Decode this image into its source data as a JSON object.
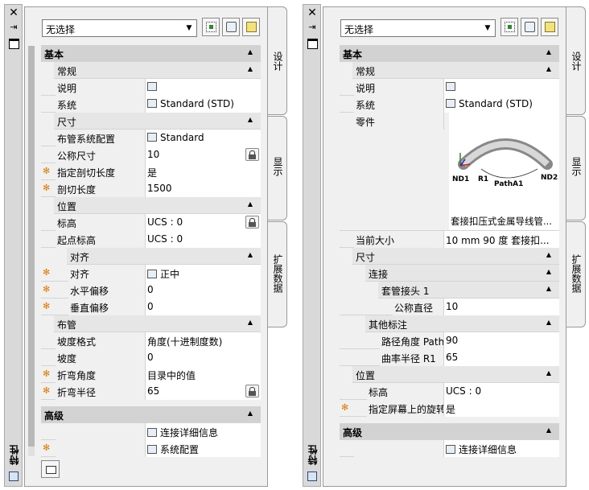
{
  "palette1": {
    "title": "特性",
    "selector": "无选择",
    "tabs": [
      "设计",
      "显示",
      "扩展数据"
    ],
    "rows": [
      {
        "kind": "cat",
        "level": 0,
        "label": "基本",
        "caret": "▲"
      },
      {
        "kind": "cat",
        "level": 1,
        "label": "常规",
        "caret": "▲"
      },
      {
        "kind": "prop",
        "level": 1,
        "label": "说明",
        "value": "",
        "icon": "table-icon"
      },
      {
        "kind": "prop",
        "level": 1,
        "label": "系统",
        "value": "Standard (STD)",
        "icon": "system-icon"
      },
      {
        "kind": "cat",
        "level": 1,
        "label": "尺寸",
        "caret": "▲"
      },
      {
        "kind": "prop",
        "level": 1,
        "label": "布管系统配置",
        "value": "Standard",
        "icon": "pipe-config-icon"
      },
      {
        "kind": "prop",
        "level": 1,
        "label": "公称尺寸",
        "value": "10",
        "lock": true
      },
      {
        "kind": "prop",
        "level": 1,
        "label": "指定剖切长度",
        "value": "是",
        "star": true
      },
      {
        "kind": "prop",
        "level": 1,
        "label": "剖切长度",
        "value": "1500",
        "star": true
      },
      {
        "kind": "cat",
        "level": 1,
        "label": "位置",
        "caret": "▲"
      },
      {
        "kind": "prop",
        "level": 1,
        "label": "标高",
        "value": "UCS : 0",
        "lock": true
      },
      {
        "kind": "prop",
        "level": 1,
        "label": "起点标高",
        "value": "UCS : 0"
      },
      {
        "kind": "cat",
        "level": 2,
        "label": "对齐",
        "caret": "▲"
      },
      {
        "kind": "prop",
        "level": 2,
        "label": "对齐",
        "value": "正中",
        "icon": "align-icon",
        "star": true
      },
      {
        "kind": "prop",
        "level": 2,
        "label": "水平偏移",
        "value": "0",
        "star": true
      },
      {
        "kind": "prop",
        "level": 2,
        "label": "垂直偏移",
        "value": "0",
        "star": true
      },
      {
        "kind": "cat",
        "level": 1,
        "label": "布管",
        "caret": "▲"
      },
      {
        "kind": "prop",
        "level": 1,
        "label": "坡度格式",
        "value": "角度(十进制度数)"
      },
      {
        "kind": "prop",
        "level": 1,
        "label": "坡度",
        "value": "0"
      },
      {
        "kind": "prop",
        "level": 1,
        "label": "折弯角度",
        "value": "目录中的值",
        "star": true
      },
      {
        "kind": "prop",
        "level": 1,
        "label": "折弯半径",
        "value": "65",
        "star": true,
        "lock": true
      },
      {
        "kind": "spacer"
      },
      {
        "kind": "cat",
        "level": 0,
        "label": "高级",
        "caret": "▲"
      },
      {
        "kind": "prop",
        "level": 1,
        "label": "",
        "value": "连接详细信息",
        "icon": "table-icon"
      },
      {
        "kind": "prop",
        "level": 1,
        "label": "",
        "value": "系统配置",
        "icon": "table-icon",
        "star": true
      }
    ]
  },
  "palette2": {
    "title": "特性",
    "selector": "无选择",
    "tabs": [
      "设计",
      "显示",
      "扩展数据"
    ],
    "preview": {
      "caption": "套接扣压式金属导线管...",
      "labels": [
        "ND1",
        "R1",
        "PathA1",
        "ND2"
      ]
    },
    "rows": [
      {
        "kind": "cat",
        "level": 0,
        "label": "基本",
        "caret": "▲"
      },
      {
        "kind": "cat",
        "level": 1,
        "label": "常规",
        "caret": "▲"
      },
      {
        "kind": "prop",
        "level": 1,
        "label": "说明",
        "value": "",
        "icon": "table-icon"
      },
      {
        "kind": "prop",
        "level": 1,
        "label": "系统",
        "value": "Standard (STD)",
        "icon": "system-icon"
      },
      {
        "kind": "preview",
        "level": 1,
        "label": "零件"
      },
      {
        "kind": "prop",
        "level": 1,
        "label": "当前大小",
        "value": "10 mm 90 度 套接扣..."
      },
      {
        "kind": "cat",
        "level": 1,
        "label": "尺寸",
        "caret": "▲"
      },
      {
        "kind": "cat",
        "level": 2,
        "label": "连接",
        "caret": "▲"
      },
      {
        "kind": "cat",
        "level": 3,
        "label": "套管接头 1",
        "caret": "▲"
      },
      {
        "kind": "prop",
        "level": 4,
        "label": "公称直径",
        "value": "10"
      },
      {
        "kind": "cat",
        "level": 2,
        "label": "其他标注",
        "caret": "▲"
      },
      {
        "kind": "prop",
        "level": 3,
        "label": "路径角度 PathA1",
        "value": "90"
      },
      {
        "kind": "prop",
        "level": 3,
        "label": "曲率半径 R1",
        "value": "65"
      },
      {
        "kind": "cat",
        "level": 1,
        "label": "位置",
        "caret": "▲"
      },
      {
        "kind": "prop",
        "level": 2,
        "label": "标高",
        "value": "UCS : 0"
      },
      {
        "kind": "prop",
        "level": 2,
        "label": "指定屏幕上的旋转",
        "value": "是",
        "star": true
      },
      {
        "kind": "spacer"
      },
      {
        "kind": "cat",
        "level": 0,
        "label": "高级",
        "caret": "▲"
      },
      {
        "kind": "prop",
        "level": 1,
        "label": "",
        "value": "连接详细信息",
        "icon": "table-icon"
      }
    ]
  }
}
